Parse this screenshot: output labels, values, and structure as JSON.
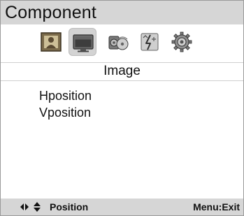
{
  "header": {
    "title": "Component"
  },
  "tabs": [
    {
      "name": "picture-frame-icon",
      "selected": false
    },
    {
      "name": "monitor-icon",
      "selected": true
    },
    {
      "name": "speaker-disc-icon",
      "selected": false
    },
    {
      "name": "clock-icon",
      "selected": false
    },
    {
      "name": "gear-icon",
      "selected": false
    }
  ],
  "submenu": {
    "title": "Image"
  },
  "menu": {
    "items": [
      "Hposition",
      "Vposition"
    ]
  },
  "footer": {
    "nav_hint": "Position",
    "exit_hint": "Menu:Exit"
  },
  "colors": {
    "bar_bg": "#d6d6d6",
    "selected_tab_bg": "#d3d3d3",
    "background": "#ffffff"
  }
}
